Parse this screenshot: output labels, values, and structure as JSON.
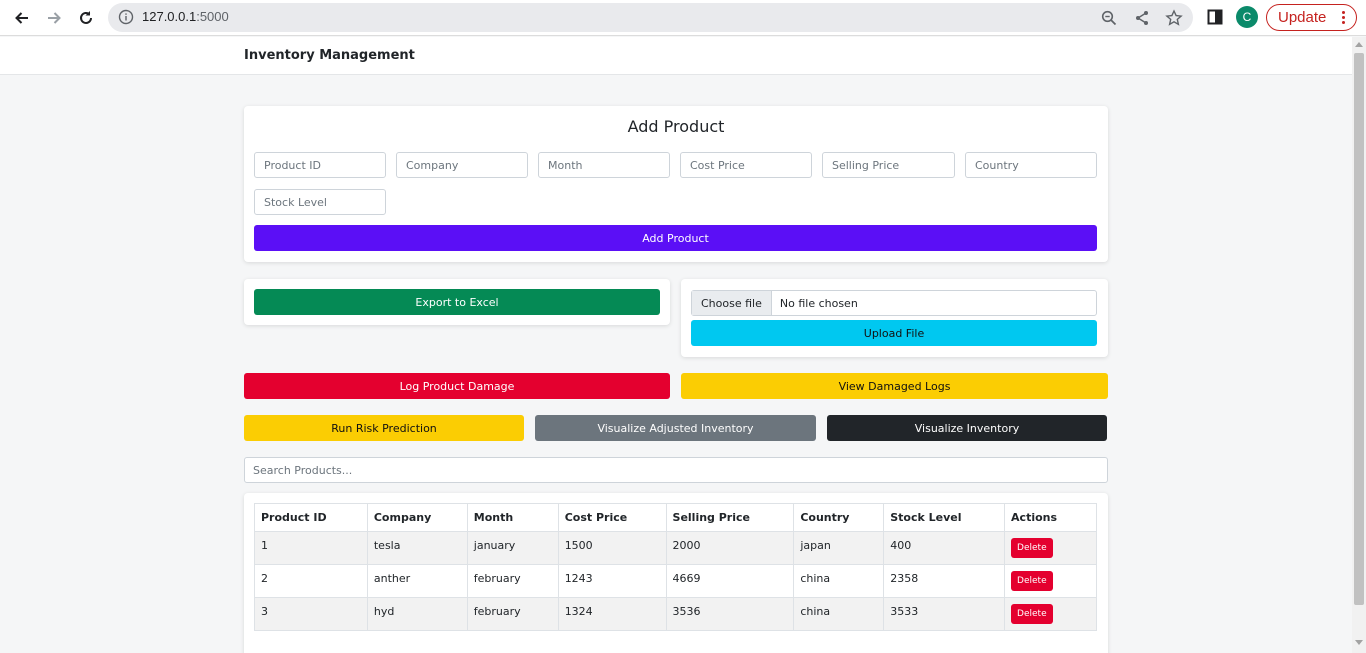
{
  "browser": {
    "url_host": "127.0.0.1",
    "url_port": ":5000",
    "avatar_letter": "C",
    "update_label": "Update"
  },
  "app": {
    "brand": "Inventory Management"
  },
  "add_product": {
    "title": "Add Product",
    "fields": {
      "product_id": "Product ID",
      "company": "Company",
      "month": "Month",
      "cost_price": "Cost Price",
      "selling_price": "Selling Price",
      "country": "Country",
      "stock_level": "Stock Level"
    },
    "submit_label": "Add Product"
  },
  "export": {
    "label": "Export to Excel"
  },
  "upload": {
    "choose_label": "Choose file",
    "status": "No file chosen",
    "upload_label": "Upload File"
  },
  "actions": {
    "log_damage": "Log Product Damage",
    "view_damaged": "View Damaged Logs",
    "risk_prediction": "Run Risk Prediction",
    "visualize_adjusted": "Visualize Adjusted Inventory",
    "visualize": "Visualize Inventory"
  },
  "search": {
    "placeholder": "Search Products..."
  },
  "table": {
    "headers": [
      "Product ID",
      "Company",
      "Month",
      "Cost Price",
      "Selling Price",
      "Country",
      "Stock Level",
      "Actions"
    ],
    "rows": [
      [
        "1",
        "tesla",
        "january",
        "1500",
        "2000",
        "japan",
        "400"
      ],
      [
        "2",
        "anther",
        "february",
        "1243",
        "4669",
        "china",
        "2358"
      ],
      [
        "3",
        "hyd",
        "february",
        "1324",
        "3536",
        "china",
        "3533"
      ]
    ],
    "delete_label": "Delete"
  },
  "colors": {
    "primary": "#5b0ff6",
    "success": "#058a55",
    "info": "#00c8f0",
    "danger": "#e4002f",
    "warning": "#fbcd03",
    "secondary": "#6c757d",
    "dark": "#212529"
  }
}
